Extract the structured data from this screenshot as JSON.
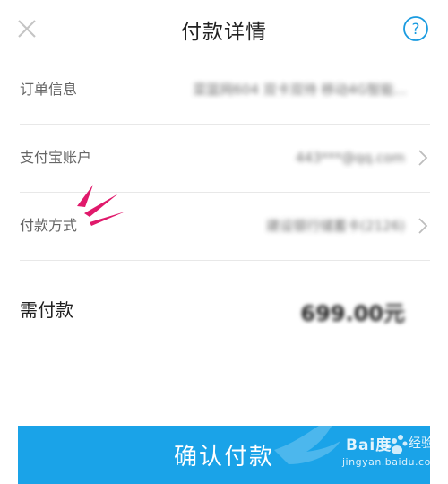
{
  "header": {
    "title": "付款详情",
    "close_icon": "close-icon",
    "help_icon": "help-icon",
    "help_color": "#1a9be0"
  },
  "rows": [
    {
      "label": "订单信息",
      "value": "菜篮网604 双卡双待 移动4G智能..."
    },
    {
      "label": "支付宝账户",
      "value": "443***@qq.com"
    },
    {
      "label": "付款方式",
      "value": "建设银行储蓄卡(2126)"
    }
  ],
  "amount": {
    "label": "需付款",
    "value": "699.00元"
  },
  "confirm": {
    "label": "确认付款",
    "color": "#1aa3e8"
  },
  "watermark": {
    "brand": "Bai度",
    "suffix": "经验",
    "url": "jingyan.baidu.com"
  },
  "annotation_color": "#e0196b"
}
